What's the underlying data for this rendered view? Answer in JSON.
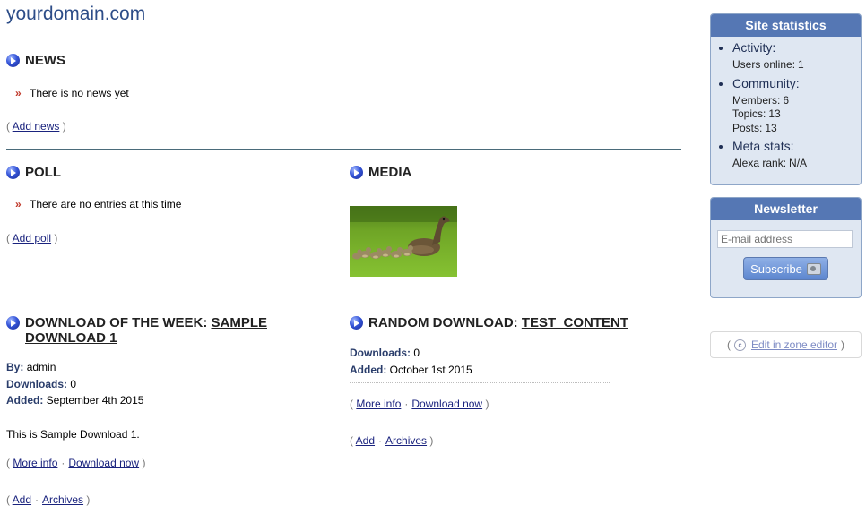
{
  "site": {
    "title": "yourdomain.com"
  },
  "news": {
    "heading": "NEWS",
    "empty_text": "There is no news yet",
    "add_label": "Add news"
  },
  "poll": {
    "heading": "POLL",
    "empty_text": "There are no entries at this time",
    "add_label": "Add poll"
  },
  "media": {
    "heading": "MEDIA"
  },
  "download_week": {
    "heading_prefix": "DOWNLOAD OF THE WEEK: ",
    "heading_link_line1": "SAMPLE",
    "heading_link_line2": "DOWNLOAD 1",
    "by_label": "By:",
    "by_value": "admin",
    "downloads_label": "Downloads:",
    "downloads_value": "0",
    "added_label": "Added:",
    "added_value": "September 4th 2015",
    "description": "This is Sample Download 1.",
    "more_info": "More info",
    "download_now": "Download now",
    "add": "Add",
    "archives": "Archives"
  },
  "random_download": {
    "heading_prefix": "RANDOM DOWNLOAD: ",
    "heading_link": "TEST_CONTENT",
    "downloads_label": "Downloads:",
    "downloads_value": "0",
    "added_label": "Added:",
    "added_value": "October 1st 2015",
    "more_info": "More info",
    "download_now": "Download now",
    "add": "Add",
    "archives": "Archives"
  },
  "stats": {
    "title": "Site statistics",
    "activity_label": "Activity:",
    "users_online_label": "Users online:",
    "users_online_value": "1",
    "community_label": "Community:",
    "members_label": "Members:",
    "members_value": "6",
    "topics_label": "Topics:",
    "topics_value": "13",
    "posts_label": "Posts:",
    "posts_value": "13",
    "meta_label": "Meta stats:",
    "alexa_label": "Alexa rank:",
    "alexa_value": "N/A"
  },
  "newsletter": {
    "title": "Newsletter",
    "email_placeholder": "E-mail address",
    "subscribe_label": "Subscribe"
  },
  "zone_editor": {
    "label": "Edit in zone editor"
  },
  "icons": {
    "block_heading": "play-circle-icon",
    "bullet": "double-chevron-icon",
    "subscribe": "camera-icon",
    "zone_editor": "copyright-c-icon"
  }
}
